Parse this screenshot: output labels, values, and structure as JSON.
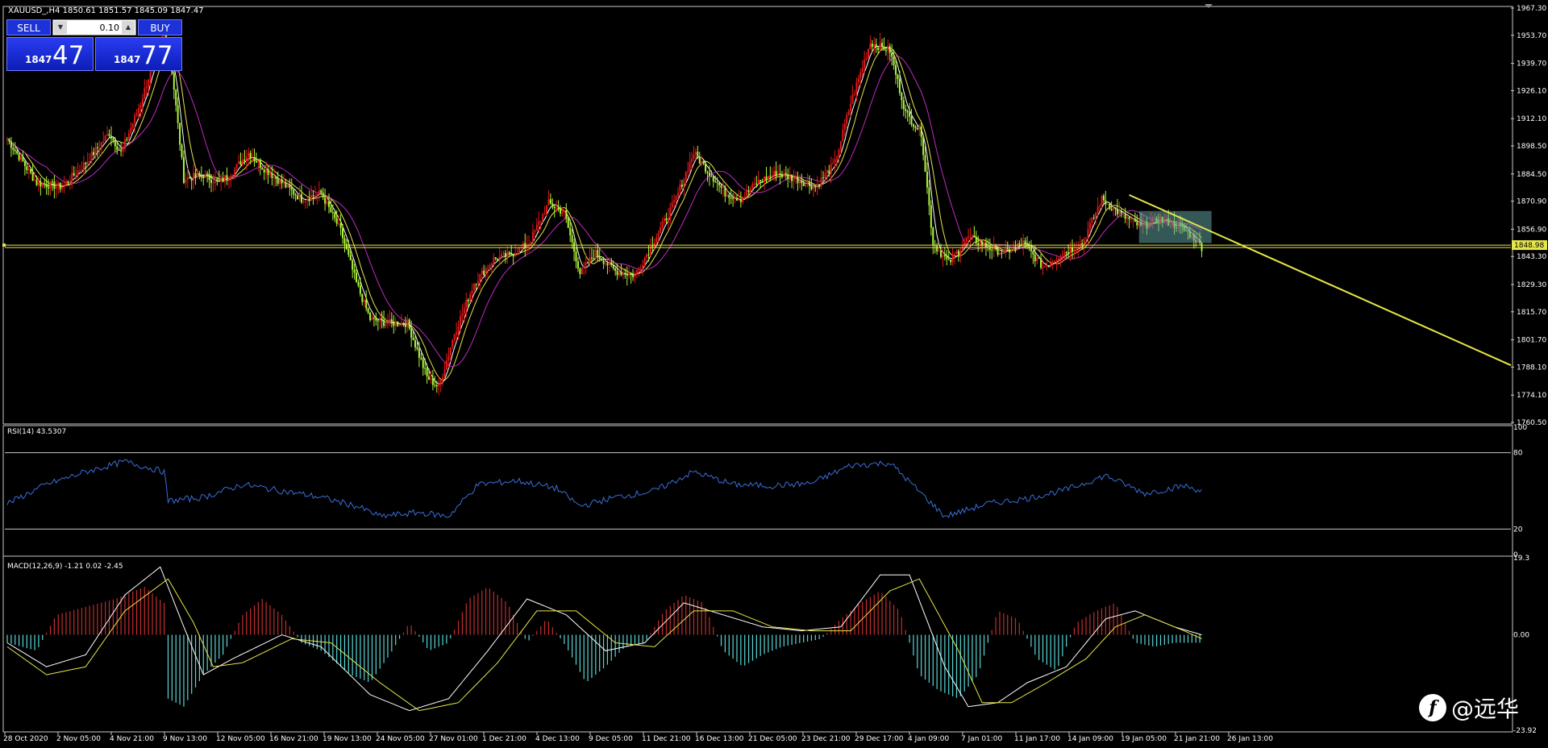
{
  "window": {
    "title": "XAUUSD_,H4  1850.61 1851.57 1845.09 1847.47"
  },
  "trade_panel": {
    "sell_label": "SELL",
    "buy_label": "BUY",
    "lot": "0.10",
    "sell_small": "1847",
    "sell_big": "47",
    "buy_small": "1847",
    "buy_big": "77"
  },
  "watermark": {
    "icon": "feather-f-logo",
    "text": "@远华"
  },
  "colors": {
    "bull": "#e01818",
    "bear": "#aef53a",
    "ma_fast": "#ffffff",
    "ma_mid": "#e6e64a",
    "ma_slow": "#c02bc0",
    "rsi": "#3a6ed8",
    "macd_pos": "#c42d2d",
    "macd_neg": "#5ad6d6",
    "macd_signal": "#e6e64a",
    "macd_main": "#ffffff",
    "level": "#e6e64a",
    "trend": "#e6e64a",
    "rect": "#5f9fa0"
  },
  "chart_data": [
    {
      "type": "candlestick",
      "title": "XAUUSD_,H4  1850.61 1851.57 1845.09 1847.47",
      "ylim": [
        1760.5,
        1967.3
      ],
      "y_ticks": [
        "1967.30",
        "1953.70",
        "1939.70",
        "1926.10",
        "1912.10",
        "1898.50",
        "1884.50",
        "1870.90",
        "1856.90",
        "1843.30",
        "1829.30",
        "1815.70",
        "1801.70",
        "1788.10",
        "1774.10",
        "1760.50"
      ],
      "price_tag": "1848.98",
      "horizontal_level": 1848.98,
      "trend_line": {
        "from": [
          "21 Jan 05:00",
          1874.0
        ],
        "to": [
          "beyond 26 Jan 13:00",
          1789.0
        ]
      },
      "shaded_zone": {
        "x": [
          "21 Jan 13:00",
          "26 Jan 21:00"
        ],
        "y": [
          1850.0,
          1866.0
        ]
      },
      "x_labels": [
        "28 Oct 2020",
        "2 Nov 05:00",
        "4 Nov 21:00",
        "9 Nov 13:00",
        "12 Nov 05:00",
        "16 Nov 21:00",
        "19 Nov 13:00",
        "24 Nov 05:00",
        "27 Nov 01:00",
        "1 Dec 21:00",
        "4 Dec 13:00",
        "9 Dec 05:00",
        "11 Dec 21:00",
        "16 Dec 13:00",
        "21 Dec 05:00",
        "23 Dec 21:00",
        "29 Dec 17:00",
        "4 Jan 09:00",
        "7 Jan 01:00",
        "11 Jan 17:00",
        "14 Jan 09:00",
        "19 Jan 05:00",
        "21 Jan 21:00",
        "26 Jan 13:00"
      ],
      "close_path": [
        [
          0,
          1902
        ],
        [
          15,
          1880
        ],
        [
          28,
          1878
        ],
        [
          40,
          1890
        ],
        [
          52,
          1905
        ],
        [
          58,
          1895
        ],
        [
          68,
          1920
        ],
        [
          76,
          1945
        ],
        [
          80,
          1955
        ],
        [
          84,
          1936
        ],
        [
          90,
          1882
        ],
        [
          100,
          1884
        ],
        [
          108,
          1880
        ],
        [
          115,
          1886
        ],
        [
          123,
          1895
        ],
        [
          130,
          1888
        ],
        [
          140,
          1880
        ],
        [
          150,
          1872
        ],
        [
          160,
          1875
        ],
        [
          170,
          1856
        ],
        [
          178,
          1830
        ],
        [
          185,
          1812
        ],
        [
          194,
          1810
        ],
        [
          204,
          1810
        ],
        [
          214,
          1783
        ],
        [
          220,
          1778
        ],
        [
          228,
          1805
        ],
        [
          238,
          1830
        ],
        [
          248,
          1842
        ],
        [
          256,
          1844
        ],
        [
          266,
          1850
        ],
        [
          276,
          1870
        ],
        [
          284,
          1865
        ],
        [
          292,
          1835
        ],
        [
          300,
          1845
        ],
        [
          310,
          1836
        ],
        [
          320,
          1834
        ],
        [
          328,
          1848
        ],
        [
          340,
          1870
        ],
        [
          350,
          1895
        ],
        [
          358,
          1885
        ],
        [
          366,
          1875
        ],
        [
          374,
          1872
        ],
        [
          382,
          1880
        ],
        [
          392,
          1885
        ],
        [
          402,
          1882
        ],
        [
          412,
          1878
        ],
        [
          422,
          1890
        ],
        [
          430,
          1920
        ],
        [
          440,
          1950
        ],
        [
          450,
          1946
        ],
        [
          458,
          1915
        ],
        [
          466,
          1905
        ],
        [
          472,
          1850
        ],
        [
          480,
          1840
        ],
        [
          490,
          1853
        ],
        [
          500,
          1848
        ],
        [
          508,
          1845
        ],
        [
          518,
          1850
        ],
        [
          528,
          1838
        ],
        [
          538,
          1845
        ],
        [
          548,
          1850
        ],
        [
          558,
          1872
        ],
        [
          568,
          1864
        ],
        [
          578,
          1858
        ],
        [
          588,
          1862
        ],
        [
          598,
          1858
        ],
        [
          606,
          1852
        ],
        [
          609,
          1848
        ]
      ]
    },
    {
      "type": "line",
      "name": "RSI(14) 43.5307",
      "ylim": [
        0,
        100
      ],
      "levels": [
        20,
        80
      ],
      "y_ticks": [
        "100",
        "80",
        "20",
        "0"
      ],
      "values": [
        [
          0,
          40
        ],
        [
          20,
          55
        ],
        [
          40,
          65
        ],
        [
          60,
          73
        ],
        [
          80,
          65
        ],
        [
          82,
          42
        ],
        [
          100,
          45
        ],
        [
          120,
          55
        ],
        [
          140,
          50
        ],
        [
          160,
          45
        ],
        [
          178,
          38
        ],
        [
          190,
          30
        ],
        [
          210,
          33
        ],
        [
          225,
          30
        ],
        [
          240,
          55
        ],
        [
          260,
          58
        ],
        [
          280,
          52
        ],
        [
          292,
          38
        ],
        [
          310,
          45
        ],
        [
          330,
          50
        ],
        [
          350,
          65
        ],
        [
          370,
          55
        ],
        [
          390,
          54
        ],
        [
          410,
          56
        ],
        [
          430,
          70
        ],
        [
          450,
          72
        ],
        [
          466,
          48
        ],
        [
          478,
          30
        ],
        [
          500,
          40
        ],
        [
          520,
          44
        ],
        [
          540,
          51
        ],
        [
          560,
          62
        ],
        [
          580,
          48
        ],
        [
          600,
          54
        ],
        [
          609,
          50
        ]
      ]
    },
    {
      "type": "macd",
      "name": "MACD(12,26,9) -1.21 0.02 -2.45",
      "ylim": [
        -23.92,
        19.3
      ],
      "y_ticks": [
        "19.3",
        "0.00",
        "-23.92"
      ],
      "histogram": [
        [
          0,
          -2
        ],
        [
          15,
          -4
        ],
        [
          25,
          5
        ],
        [
          40,
          7
        ],
        [
          55,
          9
        ],
        [
          70,
          12
        ],
        [
          80,
          8
        ],
        [
          82,
          -16
        ],
        [
          90,
          -18
        ],
        [
          100,
          -10
        ],
        [
          110,
          -5
        ],
        [
          120,
          5
        ],
        [
          130,
          9
        ],
        [
          140,
          5
        ],
        [
          150,
          -2
        ],
        [
          160,
          -4
        ],
        [
          175,
          -10
        ],
        [
          185,
          -12
        ],
        [
          195,
          -5
        ],
        [
          205,
          3
        ],
        [
          215,
          -4
        ],
        [
          225,
          -2
        ],
        [
          235,
          9
        ],
        [
          245,
          12
        ],
        [
          255,
          8
        ],
        [
          265,
          -2
        ],
        [
          275,
          4
        ],
        [
          285,
          -3
        ],
        [
          295,
          -12
        ],
        [
          305,
          -8
        ],
        [
          315,
          -3
        ],
        [
          325,
          -2
        ],
        [
          335,
          6
        ],
        [
          345,
          10
        ],
        [
          355,
          8
        ],
        [
          365,
          -4
        ],
        [
          375,
          -8
        ],
        [
          385,
          -5
        ],
        [
          395,
          -3
        ],
        [
          405,
          -2
        ],
        [
          415,
          -1
        ],
        [
          425,
          4
        ],
        [
          435,
          8
        ],
        [
          445,
          11
        ],
        [
          455,
          6
        ],
        [
          465,
          -10
        ],
        [
          475,
          -14
        ],
        [
          485,
          -16
        ],
        [
          495,
          -10
        ],
        [
          505,
          6
        ],
        [
          515,
          4
        ],
        [
          525,
          -6
        ],
        [
          535,
          -9
        ],
        [
          545,
          3
        ],
        [
          555,
          6
        ],
        [
          565,
          8
        ],
        [
          575,
          -2
        ],
        [
          585,
          -3
        ],
        [
          595,
          -2
        ],
        [
          609,
          -2
        ]
      ],
      "main": [
        [
          0,
          -2
        ],
        [
          20,
          -8
        ],
        [
          40,
          -5
        ],
        [
          60,
          10
        ],
        [
          78,
          17
        ],
        [
          90,
          2
        ],
        [
          100,
          -10
        ],
        [
          115,
          -6
        ],
        [
          140,
          0
        ],
        [
          160,
          -3
        ],
        [
          185,
          -15
        ],
        [
          205,
          -19
        ],
        [
          225,
          -16
        ],
        [
          245,
          -4
        ],
        [
          265,
          9
        ],
        [
          285,
          5
        ],
        [
          305,
          -4
        ],
        [
          325,
          -2
        ],
        [
          345,
          8
        ],
        [
          365,
          5
        ],
        [
          385,
          2
        ],
        [
          405,
          1
        ],
        [
          425,
          2
        ],
        [
          445,
          15
        ],
        [
          460,
          15
        ],
        [
          478,
          -8
        ],
        [
          490,
          -18
        ],
        [
          505,
          -17
        ],
        [
          520,
          -12
        ],
        [
          540,
          -8
        ],
        [
          560,
          4
        ],
        [
          575,
          6
        ],
        [
          595,
          2
        ],
        [
          609,
          0
        ]
      ],
      "signal": [
        [
          0,
          -3
        ],
        [
          20,
          -10
        ],
        [
          40,
          -8
        ],
        [
          60,
          6
        ],
        [
          82,
          14
        ],
        [
          95,
          3
        ],
        [
          105,
          -8
        ],
        [
          120,
          -7
        ],
        [
          145,
          -1
        ],
        [
          165,
          -2
        ],
        [
          190,
          -12
        ],
        [
          210,
          -19
        ],
        [
          230,
          -17
        ],
        [
          250,
          -7
        ],
        [
          270,
          6
        ],
        [
          290,
          6
        ],
        [
          310,
          -2
        ],
        [
          330,
          -3
        ],
        [
          350,
          6
        ],
        [
          370,
          6
        ],
        [
          390,
          2
        ],
        [
          410,
          1
        ],
        [
          430,
          1
        ],
        [
          450,
          11
        ],
        [
          465,
          14
        ],
        [
          485,
          -4
        ],
        [
          497,
          -17
        ],
        [
          512,
          -17
        ],
        [
          530,
          -12
        ],
        [
          550,
          -6
        ],
        [
          565,
          2
        ],
        [
          580,
          5
        ],
        [
          600,
          1
        ],
        [
          609,
          -1
        ]
      ]
    }
  ]
}
